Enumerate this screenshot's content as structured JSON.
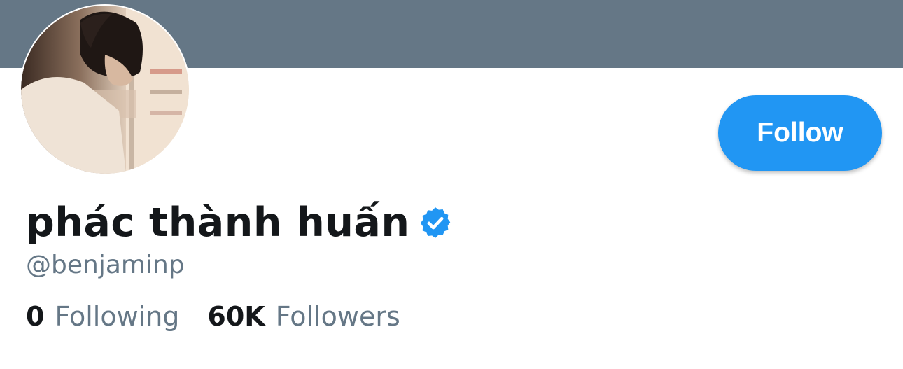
{
  "profile": {
    "display_name": "phác thành huấn",
    "handle": "@benjaminp",
    "verified": true
  },
  "actions": {
    "follow_label": "Follow"
  },
  "stats": {
    "following_count": "0",
    "following_label": "Following",
    "followers_count": "60K",
    "followers_label": "Followers"
  },
  "colors": {
    "banner": "#657786",
    "accent": "#2196f3",
    "text_primary": "#14171a",
    "text_secondary": "#657786"
  },
  "icons": {
    "verified": "verified-badge-icon"
  }
}
